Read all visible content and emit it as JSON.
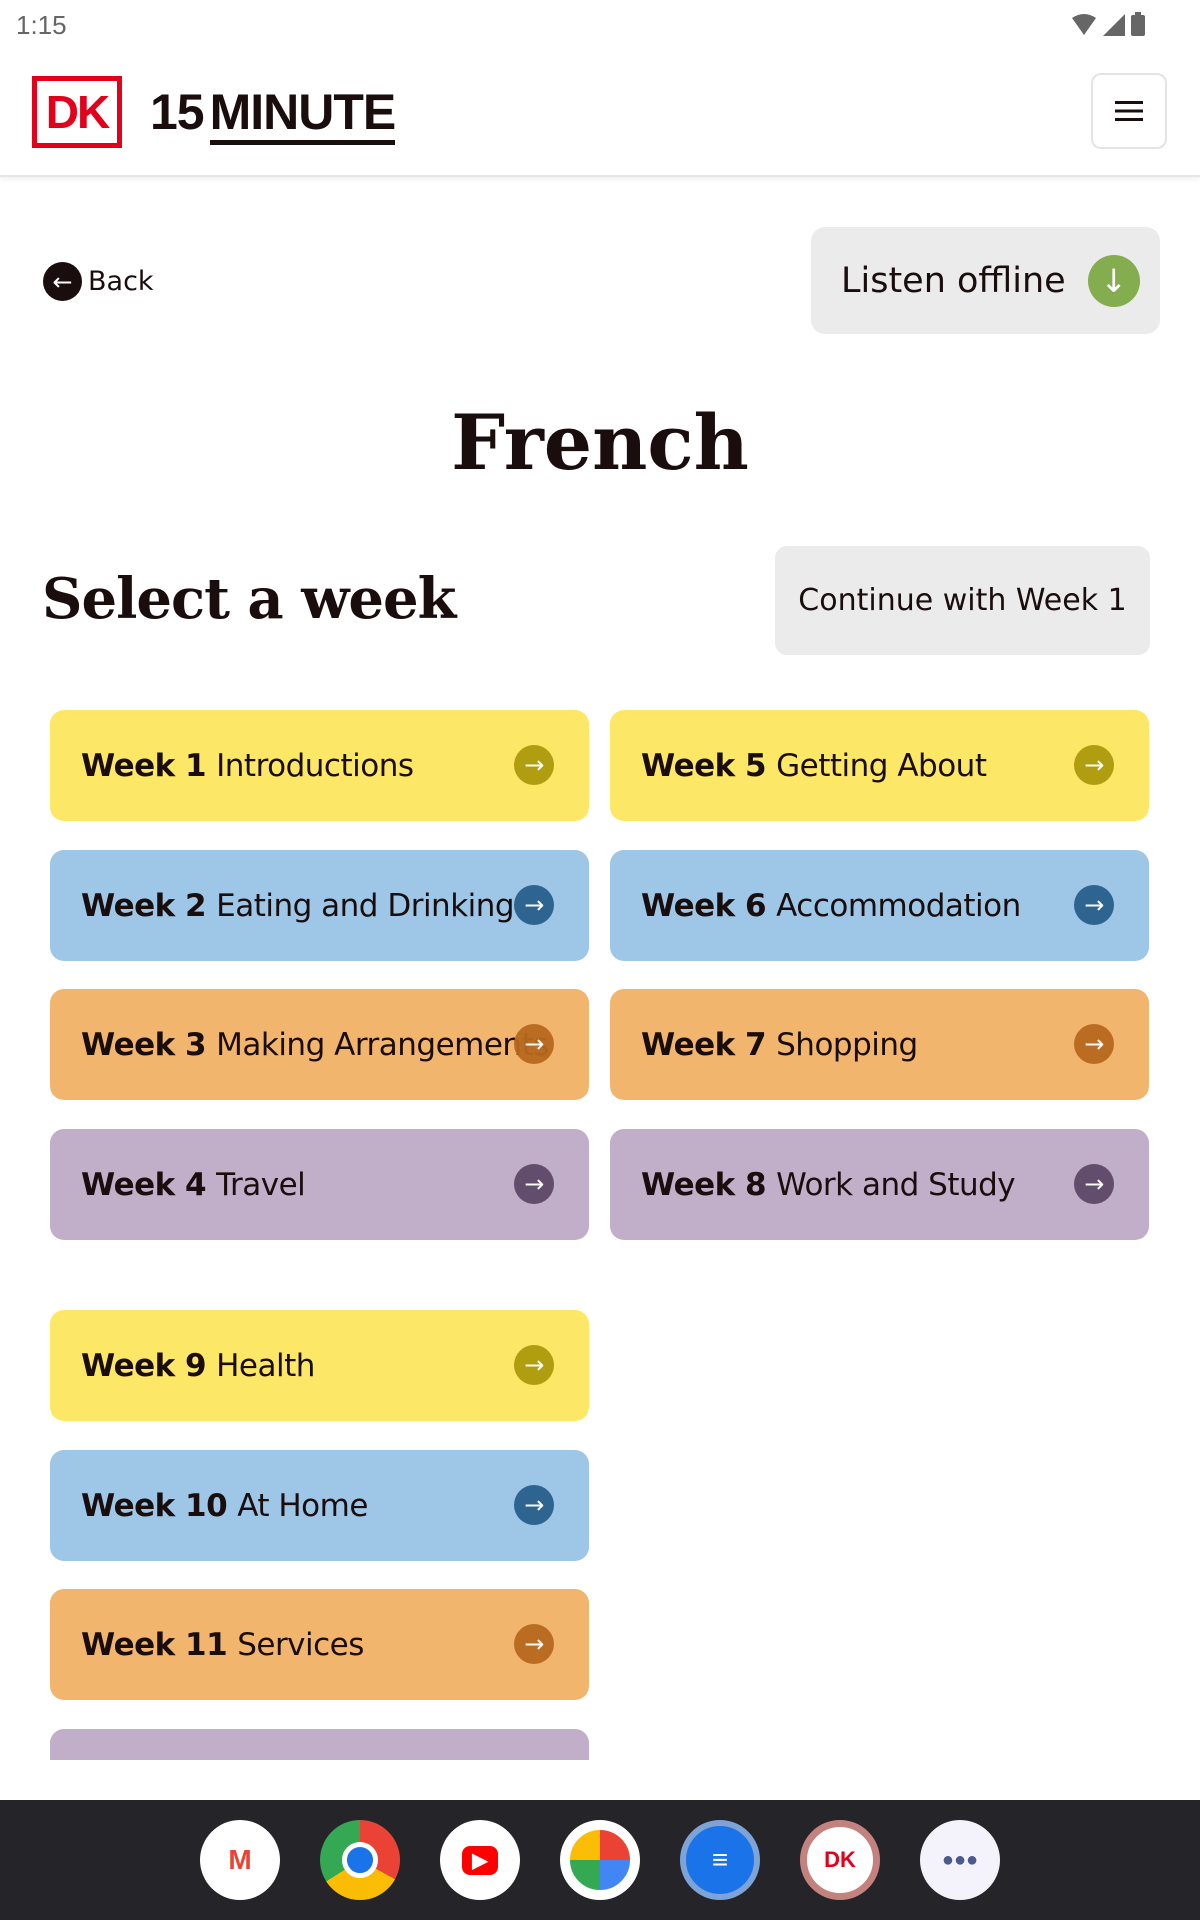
{
  "status_bar": {
    "time": "1:15",
    "icons": [
      "wifi-icon",
      "signal-icon",
      "battery-icon"
    ]
  },
  "header": {
    "logo_mark": "DK",
    "brand_number": "15",
    "brand_word": "MINUTE",
    "menu_icon": "hamburger-icon"
  },
  "back_label": "Back",
  "listen_offline_label": "Listen offline",
  "page_title": "French",
  "section_title": "Select a week",
  "continue_label": "Continue with Week 1",
  "colors": {
    "yellow": "#fde766",
    "blue": "#9dc6e7",
    "orange": "#f2b56e",
    "purple": "#c1afc9",
    "accent_green": "#84ad4f"
  },
  "weeks": [
    {
      "week": "Week 1",
      "topic": "Introductions"
    },
    {
      "week": "Week 2",
      "topic": "Eating and Drinking"
    },
    {
      "week": "Week 3",
      "topic": "Making Arrangements"
    },
    {
      "week": "Week 4",
      "topic": "Travel"
    },
    {
      "week": "Week 5",
      "topic": "Getting About"
    },
    {
      "week": "Week 6",
      "topic": "Accommodation"
    },
    {
      "week": "Week 7",
      "topic": "Shopping"
    },
    {
      "week": "Week 8",
      "topic": "Work and Study"
    },
    {
      "week": "Week 9",
      "topic": "Health"
    },
    {
      "week": "Week 10",
      "topic": "At Home"
    },
    {
      "week": "Week 11",
      "topic": "Services"
    }
  ],
  "dock": [
    "gmail",
    "chrome",
    "youtube",
    "photos",
    "messages",
    "dk-15-minute",
    "app-drawer"
  ]
}
